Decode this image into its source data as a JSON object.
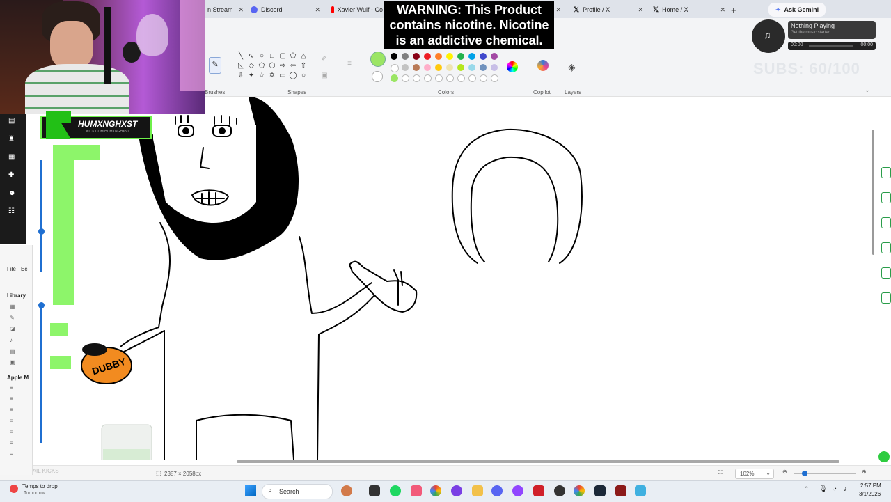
{
  "tabs": [
    {
      "label": "n Stream",
      "icon": "stream-icon"
    },
    {
      "label": "Discord",
      "icon": "discord-icon"
    },
    {
      "label": "Xavier Wulf - Co",
      "icon": "youtube-icon"
    },
    {
      "label": "Profile / X",
      "icon": "x-icon"
    },
    {
      "label": "Home / X",
      "icon": "x-icon"
    }
  ],
  "gemini_label": "Ask Gemini",
  "warning": {
    "line1": "WARNING: This Product",
    "line2": "contains nicotine. Nicotine",
    "line3": "is an addictive chemical."
  },
  "ribbon": {
    "groups": [
      "Brushes",
      "Shapes",
      "Colors",
      "Copilot",
      "Layers"
    ]
  },
  "colors": {
    "row1": [
      "#000000",
      "#7f7f7f",
      "#880015",
      "#ed1c24",
      "#ff7f27",
      "#fff200",
      "#22b14c",
      "#00a2e8",
      "#3f48cc",
      "#a349a4"
    ],
    "row2": [
      "#ffffff",
      "#c3c3c3",
      "#b97a57",
      "#ffaec9",
      "#ffc90e",
      "#efe4b0",
      "#b5e61d",
      "#99d9ea",
      "#7092be",
      "#c8bfe7"
    ],
    "selected": "#9be564"
  },
  "music": {
    "title": "Nothing Playing",
    "subtitle": "Get the music started",
    "time_start": "00:00",
    "time_end": "00:00"
  },
  "subs": "SUBS: 60/100",
  "streamer": {
    "name": "HUMXNGHXST",
    "sub": "KICK.COM/HUMXNGHXST"
  },
  "drawing": {
    "can_label": "DUBBY"
  },
  "library": {
    "menu": [
      "File",
      "Ec"
    ],
    "title": "Library",
    "apple_music": "Apple M"
  },
  "status": {
    "canvas_size": "2387 × 2058px",
    "zoom": "102%",
    "left_text": "MAIL KICKS"
  },
  "taskbar": {
    "weather_title": "Temps to drop",
    "weather_sub": "Tomorrow",
    "search": "Search",
    "time": "2:57 PM",
    "date": "3/1/2026"
  }
}
